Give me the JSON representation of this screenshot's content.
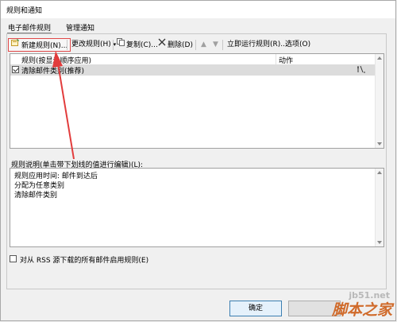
{
  "window": {
    "title": "规则和通知"
  },
  "tabs": [
    {
      "label": "电子邮件规则",
      "active": true
    },
    {
      "label": "管理通知",
      "active": false
    }
  ],
  "toolbar": {
    "new_rule": "新建规则(N)...",
    "change_rule": "更改规则(H)",
    "copy": "复制(C)...",
    "delete": "删除(D)",
    "run_rules": "立即运行规则(R)...",
    "options": "选项(O)"
  },
  "rules_table": {
    "columns": [
      "规则(按显示顺序应用)",
      "动作"
    ],
    "rows": [
      {
        "label": "清除邮件类别(推荐)",
        "checked": true,
        "selected": true
      }
    ]
  },
  "description": {
    "label": "规则说明(单击带下划线的值进行编辑)(L):",
    "lines": [
      "规则应用时间: 邮件到达后",
      "分配为任意类别",
      "清除邮件类别"
    ]
  },
  "rss": {
    "label": "对从 RSS 源下载的所有邮件启用规则(E)",
    "checked": false
  },
  "buttons": {
    "ok": "确定"
  },
  "watermark": {
    "line1": "jb51.net",
    "line2": "脚本之家"
  },
  "colors": {
    "highlight_border": "#e04848",
    "arrow": "#e23c3c",
    "selected_row": "#dcdcdc"
  }
}
